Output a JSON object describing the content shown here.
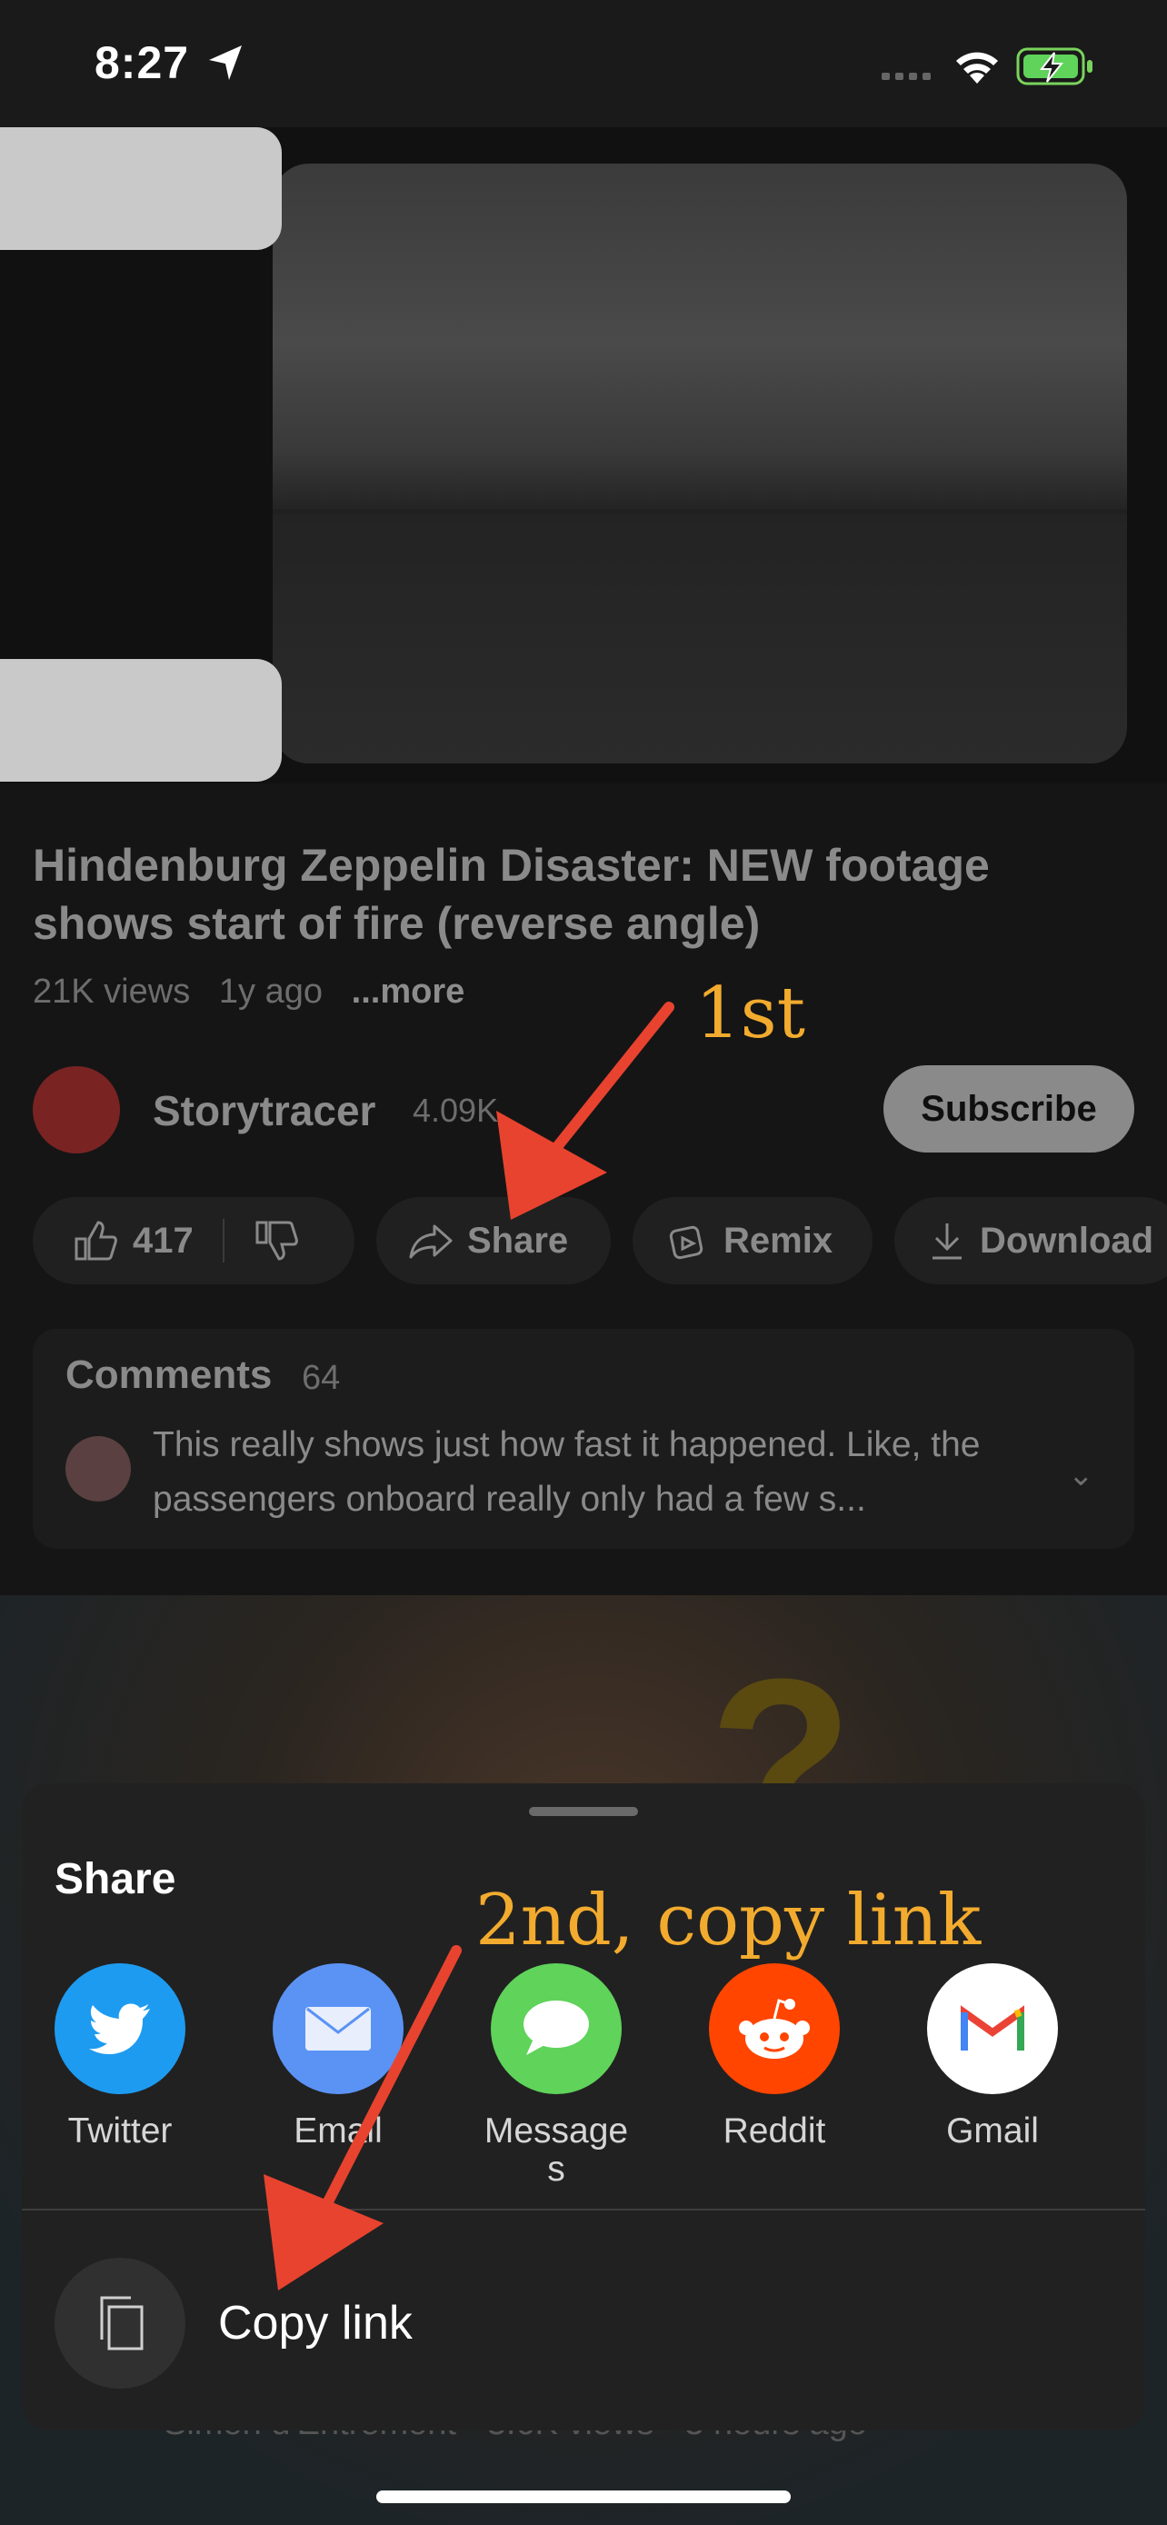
{
  "status": {
    "time": "8:27"
  },
  "video": {
    "title": "Hindenburg Zeppelin Disaster: NEW footage shows start of fire (reverse angle)",
    "views": "21K views",
    "age": "1y ago",
    "more": "...more"
  },
  "channel": {
    "name": "Storytracer",
    "subscribers": "4.09K",
    "subscribe_label": "Subscribe"
  },
  "actions": {
    "likes": "417",
    "share": "Share",
    "remix": "Remix",
    "download": "Download"
  },
  "comments": {
    "title": "Comments",
    "count": "64",
    "preview": "This really shows just how fast it happened. Like, the passengers onboard really only had a few s..."
  },
  "next_video": {
    "byline": "Simon d'Entremont · 3.6K views · 3 hours ago"
  },
  "share_sheet": {
    "title": "Share",
    "apps": [
      {
        "label": "Twitter",
        "icon": "twitter-bird-icon",
        "color": "#1d9bf0"
      },
      {
        "label": "Email",
        "icon": "envelope-icon",
        "color": "#5b93f5"
      },
      {
        "label": "Message\ns",
        "icon": "speech-bubble-icon",
        "color": "#5fd35a"
      },
      {
        "label": "Reddit",
        "icon": "reddit-alien-icon",
        "color": "#ff4500"
      },
      {
        "label": "Gmail",
        "icon": "gmail-m-icon",
        "color": "#ffffff"
      }
    ],
    "copy_link": "Copy link"
  },
  "annotations": {
    "first": "1st",
    "second": "2nd, copy link"
  },
  "colors": {
    "accent_arrow": "#e8432f",
    "annotation_text": "#f2ab2e"
  }
}
